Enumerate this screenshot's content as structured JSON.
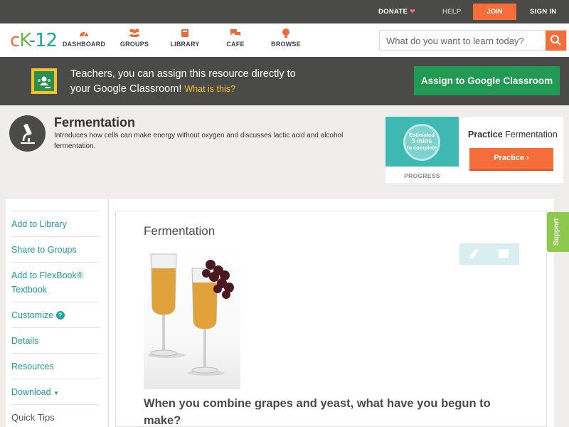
{
  "topbar": {
    "donate": "DONATE",
    "help": "HELP",
    "join": "JOIN",
    "signin": "SIGN IN"
  },
  "nav": {
    "logo_c": "c",
    "logo_k": "K",
    "logo_rest": "-12",
    "items": [
      {
        "label": "DASHBOARD",
        "icon": "dashboard-icon"
      },
      {
        "label": "GROUPS",
        "icon": "groups-icon"
      },
      {
        "label": "LIBRARY",
        "icon": "library-icon"
      },
      {
        "label": "CAFE",
        "icon": "cafe-icon"
      },
      {
        "label": "BROWSE",
        "icon": "browse-icon"
      }
    ],
    "search_placeholder": "What do you want to learn today?"
  },
  "banner": {
    "line1": "Teachers, you can assign this resource directly to",
    "line2": "your Google Classroom!",
    "what": "What is this?",
    "assign": "Assign to Google Classroom"
  },
  "concept": {
    "title": "Fermentation",
    "description": "Introduces how cells can make energy without oxygen and discusses lactic acid and alcohol fermentation."
  },
  "progress": {
    "estimated": "Estimated",
    "mins": "3 mins",
    "complete": "to complete",
    "label": "PROGRESS",
    "practice_bold": "Practice",
    "practice_name": "Fermentation",
    "button": "Practice"
  },
  "sidebar": {
    "items": [
      {
        "label": "Add to Library"
      },
      {
        "label": "Share to Groups"
      },
      {
        "label": "Add to FlexBook® Textbook"
      },
      {
        "label": "Customize"
      },
      {
        "label": "Details"
      },
      {
        "label": "Resources"
      },
      {
        "label": "Download"
      },
      {
        "label": "Quick Tips"
      }
    ]
  },
  "content": {
    "title": "Fermentation",
    "question": "When you combine grapes and yeast, what have you begun to make?"
  },
  "support": "Support",
  "colors": {
    "accent": "#f56e3a",
    "teal": "#1a9d94",
    "google_green": "#219a54",
    "dark_bar": "#4a4a48",
    "support_green": "#8cc94c"
  }
}
